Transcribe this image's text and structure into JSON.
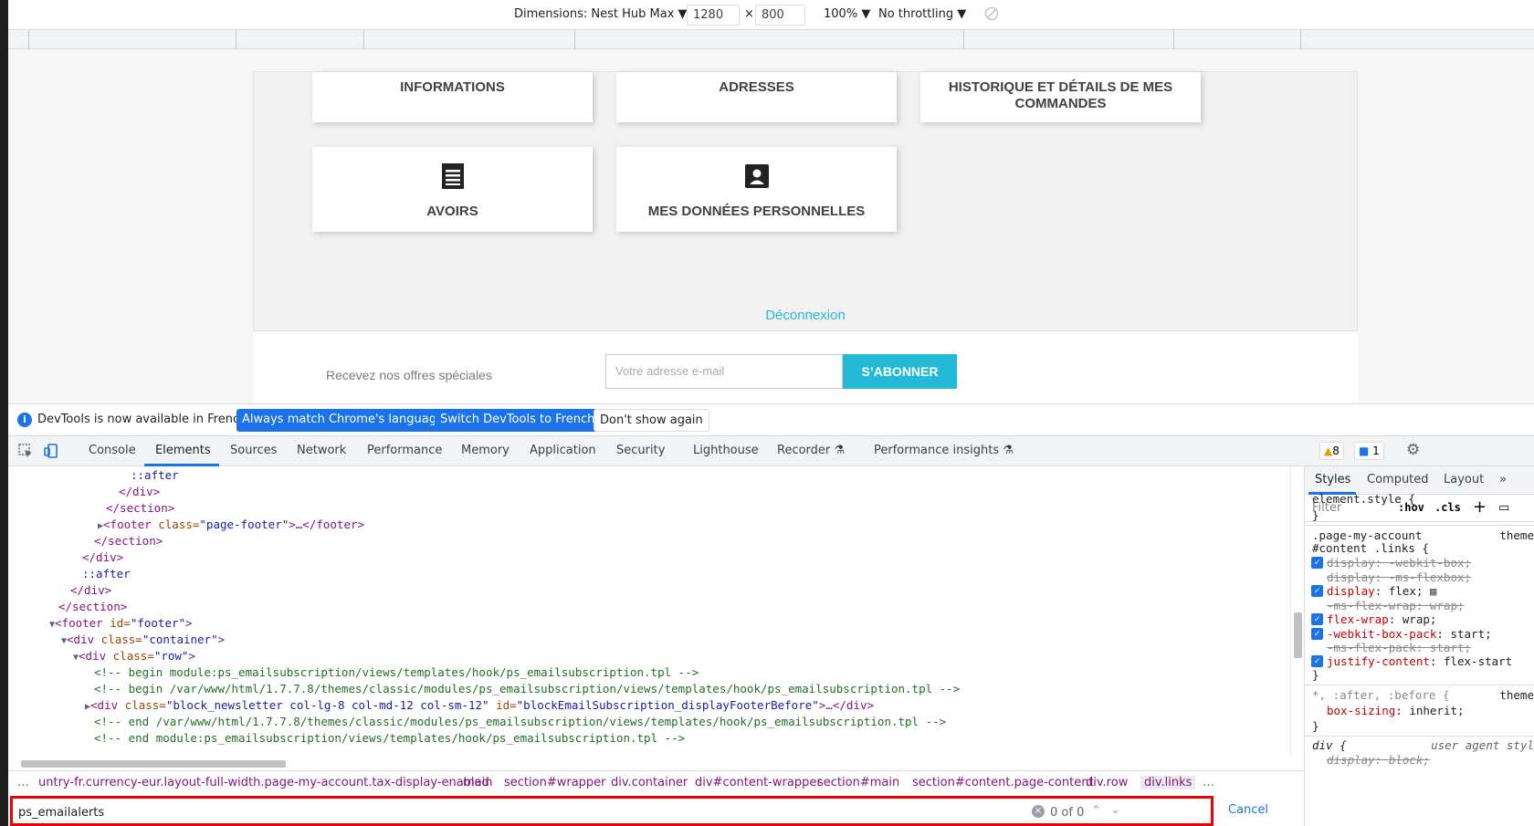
{
  "device_toolbar": {
    "dimensions_label": "Dimensions: Nest Hub Max",
    "width_value": "1280",
    "times": "×",
    "height_value": "800",
    "zoom": "100%",
    "throttling": "No throttling"
  },
  "page": {
    "cards": {
      "informations": "INFORMATIONS",
      "adresses": "ADRESSES",
      "historique": "HISTORIQUE ET DÉTAILS DE MES COMMANDES",
      "avoirs": "AVOIRS",
      "donnees": "MES DONNÉES PERSONNELLES"
    },
    "logout": "Déconnexion",
    "newsletter": {
      "text": "Recevez nos offres spéciales",
      "placeholder": "Votre adresse e-mail",
      "button": "S’ABONNER"
    }
  },
  "infobar": {
    "message": "DevTools is now available in French!",
    "btn_match": "Always match Chrome's language",
    "btn_switch": "Switch DevTools to French",
    "btn_dismiss": "Don't show again"
  },
  "tabs": {
    "console": "Console",
    "elements": "Elements",
    "sources": "Sources",
    "network": "Network",
    "performance": "Performance",
    "memory": "Memory",
    "application": "Application",
    "security": "Security",
    "lighthouse": "Lighthouse",
    "recorder": "Recorder",
    "perf_insights": "Performance insights",
    "warnings": "8",
    "messages": "1"
  },
  "elements": {
    "l1": "::after",
    "l2": "</div>",
    "l3": "</section>",
    "l4_tag": "<footer",
    "l4_attr": " class=",
    "l4_val": "\"page-footer\"",
    "l4_end": ">…</footer>",
    "l5": "</section>",
    "l6": "</div>",
    "l7": "::after",
    "l8": "</div>",
    "l9": "</section>",
    "l10_tag": "<footer",
    "l10_attr": " id=",
    "l10_val": "\"footer\"",
    "l10_end": ">",
    "l11_tag": "<div",
    "l11_attr": " class=",
    "l11_val": "\"container\"",
    "l11_end": ">",
    "l12_tag": "<div",
    "l12_attr": " class=",
    "l12_val": "\"row\"",
    "l12_end": ">",
    "l13": "<!-- begin module:ps_emailsubscription/views/templates/hook/ps_emailsubscription.tpl -->",
    "l14": "<!-- begin /var/www/html/1.7.7.8/themes/classic/modules/ps_emailsubscription/views/templates/hook/ps_emailsubscription.tpl -->",
    "l15_tag": "<div",
    "l15_attr": " class=",
    "l15_val": "\"block_newsletter col-lg-8 col-md-12 col-sm-12\"",
    "l15_attr2": " id=",
    "l15_val2": "\"blockEmailSubscription_displayFooterBefore\"",
    "l15_end": ">…</div>",
    "l16": "<!-- end /var/www/html/1.7.7.8/themes/classic/modules/ps_emailsubscription/views/templates/hook/ps_emailsubscription.tpl -->",
    "l17": "<!-- end module:ps_emailsubscription/views/templates/hook/ps_emailsubscription.tpl -->"
  },
  "breadcrumb": {
    "ellipsis": "…",
    "c1": "untry-fr.currency-eur.layout-full-width.page-my-account.tax-display-enabled",
    "c2": "main",
    "c3": "section#wrapper",
    "c4": "div.container",
    "c5": "div#content-wrapper",
    "c6": "section#main",
    "c7": "section#content.page-content",
    "c8": "div.row",
    "c9": "div.links",
    "more": "…"
  },
  "search": {
    "query": "ps_emailalerts",
    "count": "0 of 0",
    "cancel": "Cancel"
  },
  "styles": {
    "tabs": {
      "styles": "Styles",
      "computed": "Computed",
      "layout": "Layout",
      "more": "»"
    },
    "filter_placeholder": "Filter",
    "hov": ":hov",
    "cls": ".cls",
    "plus": "+",
    "element_style": "element.style {",
    "close": "}",
    "rule1_sel1": ".page-my-account",
    "rule1_src": "theme",
    "rule1_sel2": "#content .links {",
    "p1": "display: -webkit-box;",
    "p2": "display: -ms-flexbox;",
    "p3_name": "display",
    "p3_val": ": flex;",
    "p4": "-ms-flex-wrap: wrap;",
    "p5_name": "flex-wrap",
    "p5_val": ": wrap;",
    "p6_name": "-webkit-box-pack",
    "p6_val": ": start;",
    "p7": "-ms-flex-pack: start;",
    "p8_name": "justify-content",
    "p8_val": ": flex-start",
    "rule2_sel": "*, :after, :before {",
    "rule2_src": "theme",
    "rule2_prop": "box-sizing",
    "rule2_val": ": inherit;",
    "rule3_sel": "div {",
    "rule3_src": "user agent styl",
    "rule3_prop": "display: block;"
  }
}
